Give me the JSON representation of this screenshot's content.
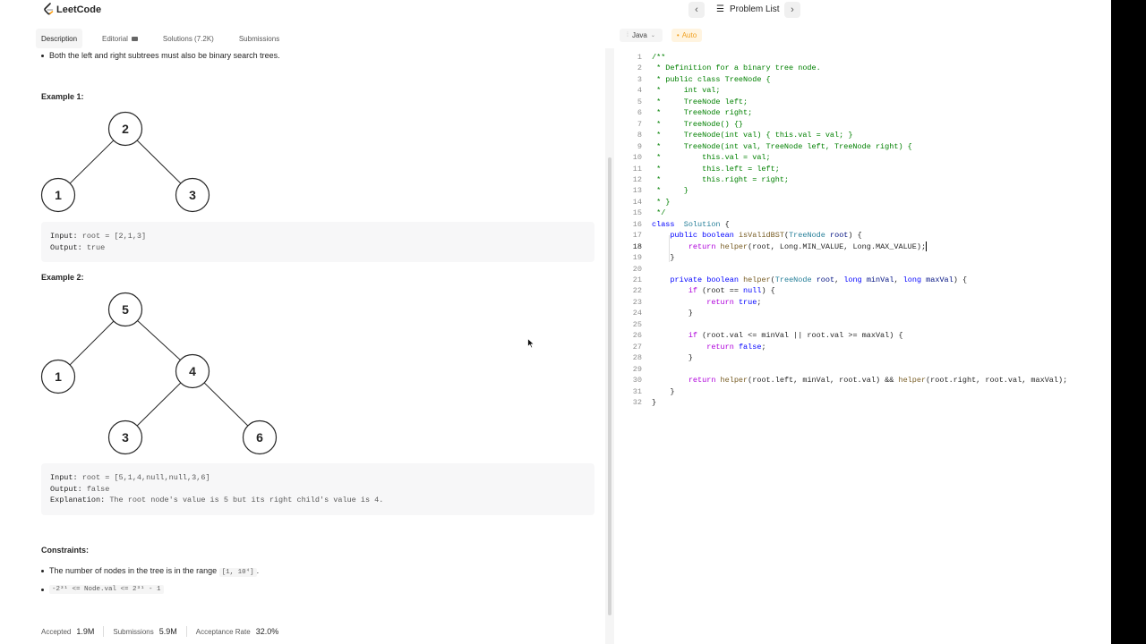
{
  "app": {
    "logo_text": "LeetCode",
    "problem_list_label": "Problem List",
    "prev_glyph": "‹",
    "next_glyph": "›"
  },
  "tabs": [
    {
      "label": "Description",
      "active": true
    },
    {
      "label": "Editorial",
      "icon": "video-icon"
    },
    {
      "label": "Solutions (7.2K)"
    },
    {
      "label": "Submissions"
    }
  ],
  "editor_toolbar": {
    "language": "Java",
    "autosave": "Auto"
  },
  "description": {
    "top_bullet": "Both the left and right subtrees must also be binary search trees.",
    "example1": {
      "title": "Example 1:",
      "tree": [
        "2",
        "1",
        "3"
      ],
      "input_key": "Input:",
      "input_val": "root = [2,1,3]",
      "output_key": "Output:",
      "output_val": "true"
    },
    "example2": {
      "title": "Example 2:",
      "tree": [
        "5",
        "1",
        "4",
        "3",
        "6"
      ],
      "input_key": "Input:",
      "input_val": "root = [5,1,4,null,null,3,6]",
      "output_key": "Output:",
      "output_val": "false",
      "explanation_key": "Explanation:",
      "explanation_val": "The root node's value is 5 but its right child's value is 4."
    },
    "constraints_title": "Constraints:",
    "constraint1_text": "The number of nodes in the tree is in the range",
    "constraint1_code": "[1, 10⁴]",
    "constraint1_end": ".",
    "constraint2_code": "-2³¹ <= Node.val <= 2³¹ - 1"
  },
  "stats": {
    "accepted_label": "Accepted",
    "accepted_val": "1.9M",
    "submissions_label": "Submissions",
    "submissions_val": "5.9M",
    "rate_label": "Acceptance Rate",
    "rate_val": "32.0%"
  },
  "code": {
    "current_line": 18,
    "lines": [
      [
        [
          "cm",
          "/**"
        ]
      ],
      [
        [
          "cm",
          " * Definition for a binary tree node."
        ]
      ],
      [
        [
          "cm",
          " * public class TreeNode {"
        ]
      ],
      [
        [
          "cm",
          " *     int val;"
        ]
      ],
      [
        [
          "cm",
          " *     TreeNode left;"
        ]
      ],
      [
        [
          "cm",
          " *     TreeNode right;"
        ]
      ],
      [
        [
          "cm",
          " *     TreeNode() {}"
        ]
      ],
      [
        [
          "cm",
          " *     TreeNode(int val) { this.val = val; }"
        ]
      ],
      [
        [
          "cm",
          " *     TreeNode(int val, TreeNode left, TreeNode right) {"
        ]
      ],
      [
        [
          "cm",
          " *         this.val = val;"
        ]
      ],
      [
        [
          "cm",
          " *         this.left = left;"
        ]
      ],
      [
        [
          "cm",
          " *         this.right = right;"
        ]
      ],
      [
        [
          "cm",
          " *     }"
        ]
      ],
      [
        [
          "cm",
          " * }"
        ]
      ],
      [
        [
          "cm",
          " */"
        ]
      ],
      [
        [
          "kw",
          "class"
        ],
        [
          "",
          "  "
        ],
        [
          "ty",
          "Solution"
        ],
        [
          "",
          " {"
        ]
      ],
      [
        [
          "",
          "    "
        ],
        [
          "kw",
          "public"
        ],
        [
          "",
          " "
        ],
        [
          "kw",
          "boolean"
        ],
        [
          "",
          " "
        ],
        [
          "fn",
          "isValidBST"
        ],
        [
          "",
          "("
        ],
        [
          "ty",
          "TreeNode"
        ],
        [
          "",
          " "
        ],
        [
          "pr",
          "root"
        ],
        [
          "",
          ") {"
        ]
      ],
      [
        [
          "",
          "        "
        ],
        [
          "kp",
          "return"
        ],
        [
          "",
          " "
        ],
        [
          "fn",
          "helper"
        ],
        [
          "",
          "(root, Long.MIN_VALUE, Long.MAX_VALUE);"
        ]
      ],
      [
        [
          "",
          "    }"
        ]
      ],
      [
        [
          "",
          ""
        ]
      ],
      [
        [
          "",
          "    "
        ],
        [
          "kw",
          "private"
        ],
        [
          "",
          " "
        ],
        [
          "kw",
          "boolean"
        ],
        [
          "",
          " "
        ],
        [
          "fn",
          "helper"
        ],
        [
          "",
          "("
        ],
        [
          "ty",
          "TreeNode"
        ],
        [
          "",
          " "
        ],
        [
          "pr",
          "root"
        ],
        [
          "",
          ", "
        ],
        [
          "kw",
          "long"
        ],
        [
          "",
          " "
        ],
        [
          "pr",
          "minVal"
        ],
        [
          "",
          ", "
        ],
        [
          "kw",
          "long"
        ],
        [
          "",
          " "
        ],
        [
          "pr",
          "maxVal"
        ],
        [
          "",
          ") {"
        ]
      ],
      [
        [
          "",
          "        "
        ],
        [
          "kp",
          "if"
        ],
        [
          "",
          " (root == "
        ],
        [
          "kw",
          "null"
        ],
        [
          "",
          ") {"
        ]
      ],
      [
        [
          "",
          "            "
        ],
        [
          "kp",
          "return"
        ],
        [
          "",
          " "
        ],
        [
          "kw",
          "true"
        ],
        [
          "",
          ";"
        ]
      ],
      [
        [
          "",
          "        }"
        ]
      ],
      [
        [
          "",
          ""
        ]
      ],
      [
        [
          "",
          "        "
        ],
        [
          "kp",
          "if"
        ],
        [
          "",
          " (root.val <= minVal || root.val >= maxVal) {"
        ]
      ],
      [
        [
          "",
          "            "
        ],
        [
          "kp",
          "return"
        ],
        [
          "",
          " "
        ],
        [
          "kw",
          "false"
        ],
        [
          "",
          ";"
        ]
      ],
      [
        [
          "",
          "        }"
        ]
      ],
      [
        [
          "",
          ""
        ]
      ],
      [
        [
          "",
          "        "
        ],
        [
          "kp",
          "return"
        ],
        [
          "",
          " "
        ],
        [
          "fn",
          "helper"
        ],
        [
          "",
          "(root.left, minVal, root.val) && "
        ],
        [
          "fn",
          "helper"
        ],
        [
          "",
          "(root.right, root.val, maxVal);"
        ]
      ],
      [
        [
          "",
          "    }"
        ]
      ],
      [
        [
          "",
          "}"
        ]
      ]
    ]
  },
  "colors": {
    "comment": "#008000",
    "keyword": "#0000ff",
    "control": "#af00db",
    "type": "#267f99",
    "function": "#795e26",
    "param": "#001080",
    "auto_badge": "#f0a020"
  }
}
